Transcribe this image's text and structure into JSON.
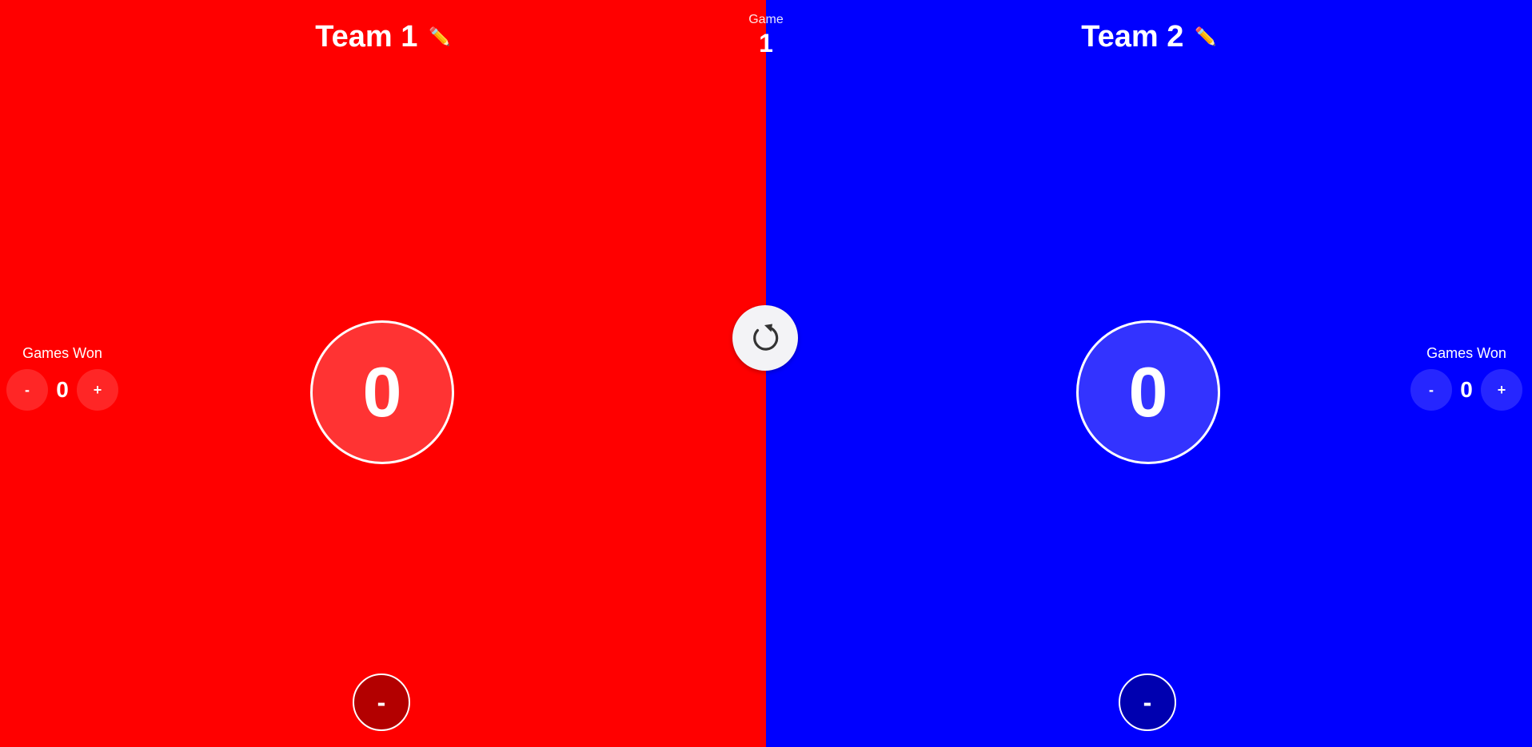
{
  "game": {
    "label": "Game",
    "number": "1"
  },
  "teams": [
    {
      "name": "Team 1",
      "edit_icon": "✏️",
      "score": "0",
      "minus_label": "-",
      "color": "#ff0000",
      "games_won": {
        "label": "Games Won",
        "value": "0",
        "decrement_label": "-",
        "increment_label": "+"
      }
    },
    {
      "name": "Team 2",
      "edit_icon": "✏️",
      "score": "0",
      "minus_label": "-",
      "color": "#0000ff",
      "games_won": {
        "label": "Games Won",
        "value": "0",
        "decrement_label": "-",
        "increment_label": "+"
      }
    }
  ],
  "reset": {
    "icon": "reset-icon"
  }
}
